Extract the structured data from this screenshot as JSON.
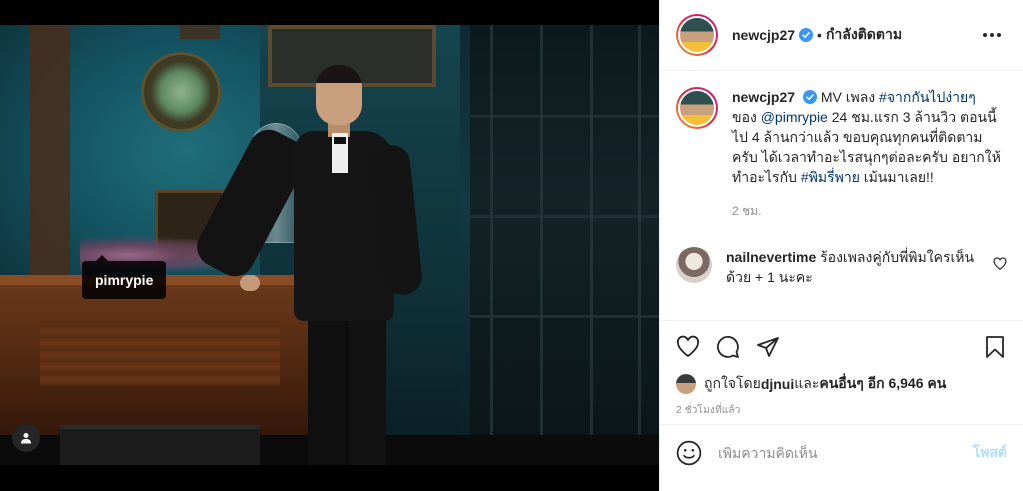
{
  "photo": {
    "tag_username": "pimrypie"
  },
  "header": {
    "username": "newcjp27",
    "separator": "•",
    "follow_label": "กำลังติดตาม"
  },
  "caption": {
    "username": "newcjp27",
    "parts": {
      "t1": "MV เพลง ",
      "hashtag1": "#จากกันไปง่ายๆ",
      "t2": "ของ ",
      "mention": "@pimrypie",
      "t3": " 24 ชม.แรก 3 ล้านวิว ตอนนี้ไป 4 ล้านกว่าแล้ว ขอบคุณทุกคนที่ติดตามครับ ได้เวลาทำอะไรสนุกๆต่อละครับ อยากให้ทำอะไรกับ ",
      "hashtag2": "#พิมรี่พาย",
      "t4": " เม้นมาเลย!!"
    },
    "time": "2 ชม."
  },
  "reply": {
    "username": "nailnevertime",
    "text": " ร้องเพลงคู่กับพี่พิมใครเห็นด้วย + 1 นะคะ"
  },
  "likes": {
    "prefix": "ถูกใจโดย ",
    "user": "djnui",
    "middle": " และ ",
    "others": "คนอื่นๆ อีก 6,946 คน"
  },
  "posted_time": "2 ชั่วโมงที่แล้ว",
  "composer": {
    "placeholder": "เพิ่มความคิดเห็น",
    "post_label": "โพสต์"
  }
}
